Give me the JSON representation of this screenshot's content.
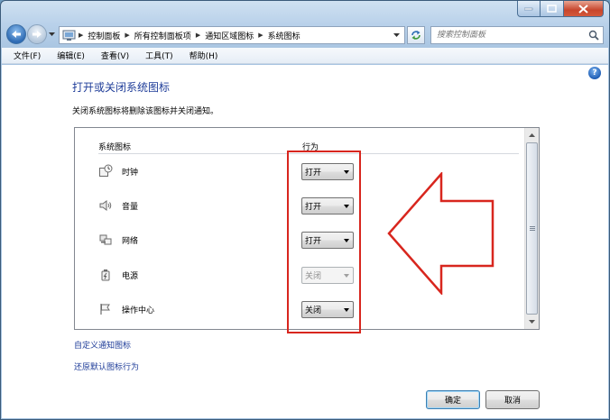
{
  "address": {
    "breadcrumb": [
      "控制面板",
      "所有控制面板项",
      "通知区域图标",
      "系统图标"
    ]
  },
  "search": {
    "placeholder": "搜索控制面板"
  },
  "menu": [
    "文件(F)",
    "编辑(E)",
    "查看(V)",
    "工具(T)",
    "帮助(H)"
  ],
  "page": {
    "title": "打开或关闭系统图标",
    "description": "关闭系统图标将删除该图标并关闭通知。"
  },
  "table": {
    "col_icons": "系统图标",
    "col_action": "行为",
    "rows": [
      {
        "name": "时钟",
        "icon": "clock-icon",
        "action": "打开",
        "enabled": true
      },
      {
        "name": "音量",
        "icon": "speaker-icon",
        "action": "打开",
        "enabled": true
      },
      {
        "name": "网络",
        "icon": "network-icon",
        "action": "打开",
        "enabled": true
      },
      {
        "name": "电源",
        "icon": "power-icon",
        "action": "关闭",
        "enabled": false
      },
      {
        "name": "操作中心",
        "icon": "flag-icon",
        "action": "关闭",
        "enabled": true
      }
    ]
  },
  "links": {
    "customize": "自定义通知图标",
    "restore": "还原默认图标行为"
  },
  "buttons": {
    "ok": "确定",
    "cancel": "取消"
  },
  "colors": {
    "annotation": "#d8261e",
    "link": "#1f3d99"
  }
}
